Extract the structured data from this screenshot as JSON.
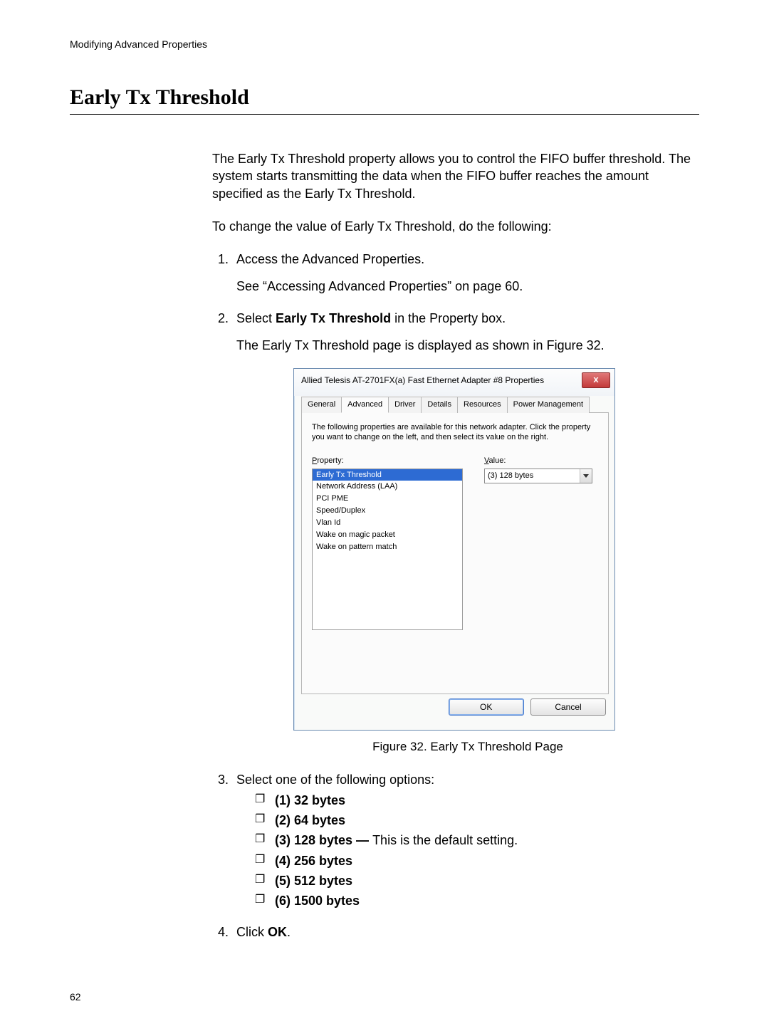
{
  "header": {
    "running": "Modifying Advanced Properties"
  },
  "title": "Early Tx Threshold",
  "intro": {
    "p1": "The Early Tx Threshold property allows you to control the FIFO buffer threshold. The system starts transmitting the data when the FIFO buffer reaches the amount specified as the Early Tx Threshold.",
    "p2": "To change the value of Early Tx Threshold, do the following:"
  },
  "steps": {
    "s1": {
      "text": "Access the Advanced Properties.",
      "sub": "See “Accessing Advanced Properties” on page 60."
    },
    "s2": {
      "pre": "Select ",
      "bold": "Early Tx Threshold",
      "post": " in the Property box.",
      "sub": "The Early Tx Threshold page is displayed as shown in Figure 32."
    },
    "s3": {
      "text": "Select one of the following options:"
    },
    "s4": {
      "pre": "Click ",
      "bold": "OK",
      "post": "."
    }
  },
  "options": {
    "o1": {
      "bold": "(1) 32 bytes",
      "rest": ""
    },
    "o2": {
      "bold": "(2) 64 bytes",
      "rest": ""
    },
    "o3": {
      "bold": "(3) 128 bytes — ",
      "rest": "This is the default setting."
    },
    "o4": {
      "bold": "(4) 256 bytes",
      "rest": ""
    },
    "o5": {
      "bold": "(5) 512 bytes",
      "rest": ""
    },
    "o6": {
      "bold": "(6) 1500 bytes",
      "rest": ""
    }
  },
  "dialog": {
    "title": "Allied Telesis AT-2701FX(a) Fast Ethernet Adapter #8 Properties",
    "tabs": {
      "general": "General",
      "advanced": "Advanced",
      "driver": "Driver",
      "details": "Details",
      "resources": "Resources",
      "pm": "Power Management"
    },
    "desc": "The following properties are available for this network adapter. Click the property you want to change on the left, and then select its value on the right.",
    "labels": {
      "property": "Property:",
      "value": "Value:"
    },
    "properties": {
      "p0": "Early Tx Threshold",
      "p1": "Network Address (LAA)",
      "p2": "PCI PME",
      "p3": "Speed/Duplex",
      "p4": "Vlan Id",
      "p5": "Wake on magic packet",
      "p6": "Wake on pattern match"
    },
    "value": "(3) 128 bytes",
    "buttons": {
      "ok": "OK",
      "cancel": "Cancel"
    }
  },
  "figure_caption": "Figure 32. Early Tx Threshold Page",
  "page_number": "62"
}
